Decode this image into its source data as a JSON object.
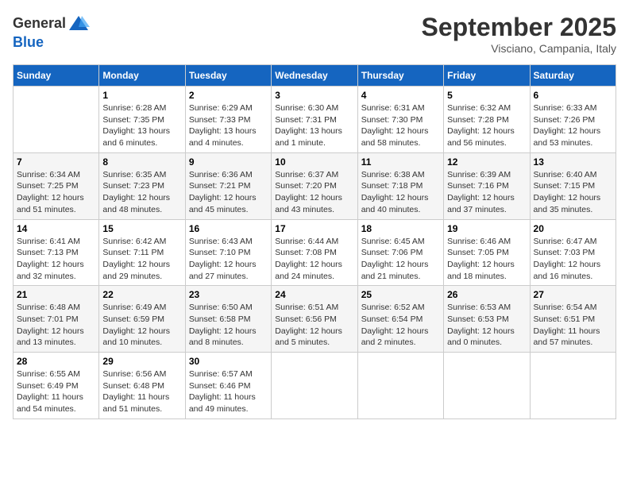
{
  "header": {
    "logo_general": "General",
    "logo_blue": "Blue",
    "month_title": "September 2025",
    "location": "Visciano, Campania, Italy"
  },
  "weekdays": [
    "Sunday",
    "Monday",
    "Tuesday",
    "Wednesday",
    "Thursday",
    "Friday",
    "Saturday"
  ],
  "weeks": [
    [
      {
        "day": "",
        "info": ""
      },
      {
        "day": "1",
        "info": "Sunrise: 6:28 AM\nSunset: 7:35 PM\nDaylight: 13 hours\nand 6 minutes."
      },
      {
        "day": "2",
        "info": "Sunrise: 6:29 AM\nSunset: 7:33 PM\nDaylight: 13 hours\nand 4 minutes."
      },
      {
        "day": "3",
        "info": "Sunrise: 6:30 AM\nSunset: 7:31 PM\nDaylight: 13 hours\nand 1 minute."
      },
      {
        "day": "4",
        "info": "Sunrise: 6:31 AM\nSunset: 7:30 PM\nDaylight: 12 hours\nand 58 minutes."
      },
      {
        "day": "5",
        "info": "Sunrise: 6:32 AM\nSunset: 7:28 PM\nDaylight: 12 hours\nand 56 minutes."
      },
      {
        "day": "6",
        "info": "Sunrise: 6:33 AM\nSunset: 7:26 PM\nDaylight: 12 hours\nand 53 minutes."
      }
    ],
    [
      {
        "day": "7",
        "info": "Sunrise: 6:34 AM\nSunset: 7:25 PM\nDaylight: 12 hours\nand 51 minutes."
      },
      {
        "day": "8",
        "info": "Sunrise: 6:35 AM\nSunset: 7:23 PM\nDaylight: 12 hours\nand 48 minutes."
      },
      {
        "day": "9",
        "info": "Sunrise: 6:36 AM\nSunset: 7:21 PM\nDaylight: 12 hours\nand 45 minutes."
      },
      {
        "day": "10",
        "info": "Sunrise: 6:37 AM\nSunset: 7:20 PM\nDaylight: 12 hours\nand 43 minutes."
      },
      {
        "day": "11",
        "info": "Sunrise: 6:38 AM\nSunset: 7:18 PM\nDaylight: 12 hours\nand 40 minutes."
      },
      {
        "day": "12",
        "info": "Sunrise: 6:39 AM\nSunset: 7:16 PM\nDaylight: 12 hours\nand 37 minutes."
      },
      {
        "day": "13",
        "info": "Sunrise: 6:40 AM\nSunset: 7:15 PM\nDaylight: 12 hours\nand 35 minutes."
      }
    ],
    [
      {
        "day": "14",
        "info": "Sunrise: 6:41 AM\nSunset: 7:13 PM\nDaylight: 12 hours\nand 32 minutes."
      },
      {
        "day": "15",
        "info": "Sunrise: 6:42 AM\nSunset: 7:11 PM\nDaylight: 12 hours\nand 29 minutes."
      },
      {
        "day": "16",
        "info": "Sunrise: 6:43 AM\nSunset: 7:10 PM\nDaylight: 12 hours\nand 27 minutes."
      },
      {
        "day": "17",
        "info": "Sunrise: 6:44 AM\nSunset: 7:08 PM\nDaylight: 12 hours\nand 24 minutes."
      },
      {
        "day": "18",
        "info": "Sunrise: 6:45 AM\nSunset: 7:06 PM\nDaylight: 12 hours\nand 21 minutes."
      },
      {
        "day": "19",
        "info": "Sunrise: 6:46 AM\nSunset: 7:05 PM\nDaylight: 12 hours\nand 18 minutes."
      },
      {
        "day": "20",
        "info": "Sunrise: 6:47 AM\nSunset: 7:03 PM\nDaylight: 12 hours\nand 16 minutes."
      }
    ],
    [
      {
        "day": "21",
        "info": "Sunrise: 6:48 AM\nSunset: 7:01 PM\nDaylight: 12 hours\nand 13 minutes."
      },
      {
        "day": "22",
        "info": "Sunrise: 6:49 AM\nSunset: 6:59 PM\nDaylight: 12 hours\nand 10 minutes."
      },
      {
        "day": "23",
        "info": "Sunrise: 6:50 AM\nSunset: 6:58 PM\nDaylight: 12 hours\nand 8 minutes."
      },
      {
        "day": "24",
        "info": "Sunrise: 6:51 AM\nSunset: 6:56 PM\nDaylight: 12 hours\nand 5 minutes."
      },
      {
        "day": "25",
        "info": "Sunrise: 6:52 AM\nSunset: 6:54 PM\nDaylight: 12 hours\nand 2 minutes."
      },
      {
        "day": "26",
        "info": "Sunrise: 6:53 AM\nSunset: 6:53 PM\nDaylight: 12 hours\nand 0 minutes."
      },
      {
        "day": "27",
        "info": "Sunrise: 6:54 AM\nSunset: 6:51 PM\nDaylight: 11 hours\nand 57 minutes."
      }
    ],
    [
      {
        "day": "28",
        "info": "Sunrise: 6:55 AM\nSunset: 6:49 PM\nDaylight: 11 hours\nand 54 minutes."
      },
      {
        "day": "29",
        "info": "Sunrise: 6:56 AM\nSunset: 6:48 PM\nDaylight: 11 hours\nand 51 minutes."
      },
      {
        "day": "30",
        "info": "Sunrise: 6:57 AM\nSunset: 6:46 PM\nDaylight: 11 hours\nand 49 minutes."
      },
      {
        "day": "",
        "info": ""
      },
      {
        "day": "",
        "info": ""
      },
      {
        "day": "",
        "info": ""
      },
      {
        "day": "",
        "info": ""
      }
    ]
  ]
}
